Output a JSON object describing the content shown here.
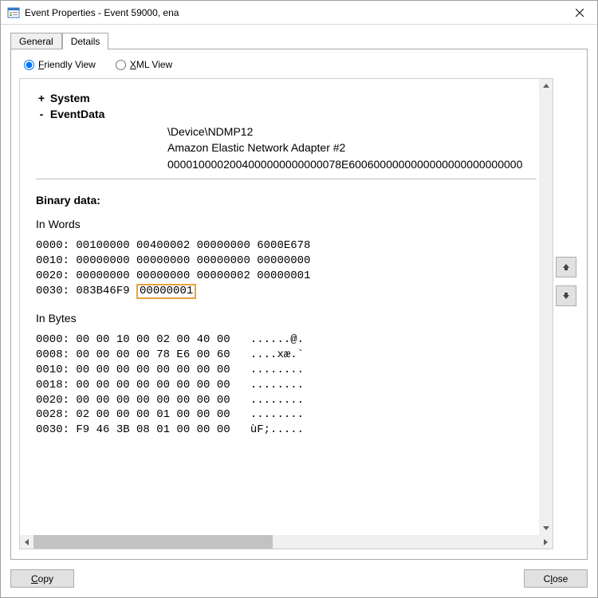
{
  "window": {
    "title": "Event Properties - Event 59000, ena"
  },
  "tabs": {
    "general": "General",
    "details": "Details"
  },
  "view": {
    "friendly_label": "Friendly View",
    "xml_label": "XML View"
  },
  "tree": {
    "system_toggle": "+",
    "system_label": "System",
    "eventdata_toggle": "-",
    "eventdata_label": "EventData"
  },
  "eventdata": {
    "line1": "\\Device\\NDMP12",
    "line2": "Amazon Elastic Network Adapter #2",
    "line3": "0000100002004000000000000078E6006000000000000000000000000"
  },
  "binary": {
    "title": "Binary data:",
    "words_title": "In Words",
    "words_l1": "0000: 00100000 00400002 00000000 6000E678",
    "words_l2": "0010: 00000000 00000000 00000000 00000000",
    "words_l3": "0020: 00000000 00000000 00000002 00000001",
    "words_l4_a": "0030: 083B46F9 ",
    "words_l4_hl": "00000001",
    "bytes_title": "In Bytes",
    "bytes_l1": "0000: 00 00 10 00 02 00 40 00   ......@.",
    "bytes_l2": "0008: 00 00 00 00 78 E6 00 60   ....xæ.`",
    "bytes_l3": "0010: 00 00 00 00 00 00 00 00   ........",
    "bytes_l4": "0018: 00 00 00 00 00 00 00 00   ........",
    "bytes_l5": "0020: 00 00 00 00 00 00 00 00   ........",
    "bytes_l6": "0028: 02 00 00 00 01 00 00 00   ........",
    "bytes_l7": "0030: F9 46 3B 08 01 00 00 00   ùF;....."
  },
  "buttons": {
    "copy": "Copy",
    "close": "Close"
  }
}
